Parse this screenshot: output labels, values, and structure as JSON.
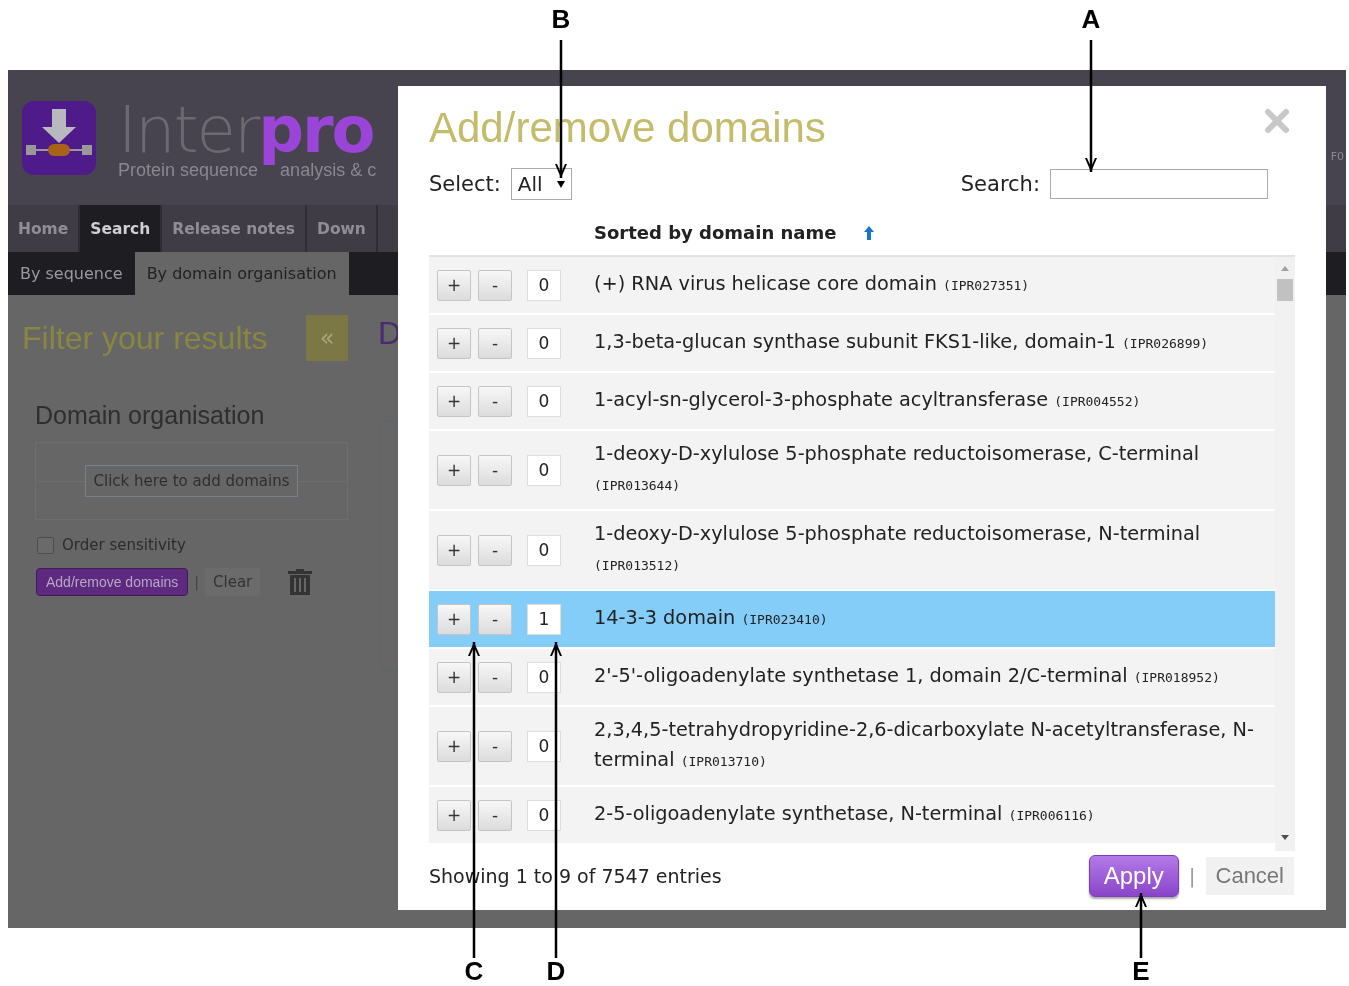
{
  "page": {
    "logo": {
      "word_a": "Inter",
      "word_b": "pro",
      "tagline_a": "Protein sequence",
      "tagline_b": "analysis & c"
    },
    "header_edge_text": "F0",
    "nav": [
      {
        "label": "Home",
        "selected": false
      },
      {
        "label": "Search",
        "selected": true
      },
      {
        "label": "Release notes",
        "selected": false
      },
      {
        "label": "Down",
        "selected": false
      }
    ],
    "subnav": [
      {
        "label": "By sequence",
        "selected": false
      },
      {
        "label": "By domain organisation",
        "selected": true
      }
    ],
    "sidebar": {
      "title": "Filter your results",
      "collapse_button": "«",
      "section_title": "Domain organisation",
      "drop_button": "Click here to add domains",
      "order_sensitivity": {
        "label": "Order sensitivity",
        "checked": false
      },
      "add_remove_button": "Add/remove domains",
      "separator": "|",
      "clear_button": "Clear"
    },
    "main_heading": "D"
  },
  "dialog": {
    "title": "Add/remove domains",
    "select_label": "Select:",
    "select_value": "All",
    "search_label": "Search:",
    "sort_header": "Sorted by domain name",
    "rows": [
      {
        "plus": "+",
        "minus": "-",
        "count": "0",
        "name": "(+) RNA virus helicase core domain",
        "id": "(IPR027351)",
        "selected": false
      },
      {
        "plus": "+",
        "minus": "-",
        "count": "0",
        "name": "1,3-beta-glucan synthase subunit FKS1-like, domain-1",
        "id": "(IPR026899)",
        "selected": false
      },
      {
        "plus": "+",
        "minus": "-",
        "count": "0",
        "name": "1-acyl-sn-glycerol-3-phosphate acyltransferase",
        "id": "(IPR004552)",
        "selected": false
      },
      {
        "plus": "+",
        "minus": "-",
        "count": "0",
        "name": "1-deoxy-D-xylulose 5-phosphate reductoisomerase, C-terminal",
        "id": "(IPR013644)",
        "selected": false
      },
      {
        "plus": "+",
        "minus": "-",
        "count": "0",
        "name": "1-deoxy-D-xylulose 5-phosphate reductoisomerase, N-terminal",
        "id": "(IPR013512)",
        "selected": false
      },
      {
        "plus": "+",
        "minus": "-",
        "count": "1",
        "name": "14-3-3 domain",
        "id": "(IPR023410)",
        "selected": true
      },
      {
        "plus": "+",
        "minus": "-",
        "count": "0",
        "name": "2'-5'-oligoadenylate synthetase 1, domain 2/C-terminal",
        "id": "(IPR018952)",
        "selected": false
      },
      {
        "plus": "+",
        "minus": "-",
        "count": "0",
        "name": "2,3,4,5-tetrahydropyridine-2,6-dicarboxylate N-acetyltransferase, N-terminal",
        "id": "(IPR013710)",
        "selected": false
      },
      {
        "plus": "+",
        "minus": "-",
        "count": "0",
        "name": "2-5-oligoadenylate synthetase, N-terminal",
        "id": "(IPR006116)",
        "selected": false
      }
    ],
    "footer": "Showing 1 to 9 of 7547 entries",
    "apply_button": "Apply",
    "separator": "|",
    "cancel_button": "Cancel"
  },
  "callouts": [
    {
      "label": "B"
    },
    {
      "label": "A"
    },
    {
      "label": "C"
    },
    {
      "label": "D"
    },
    {
      "label": "E"
    }
  ]
}
